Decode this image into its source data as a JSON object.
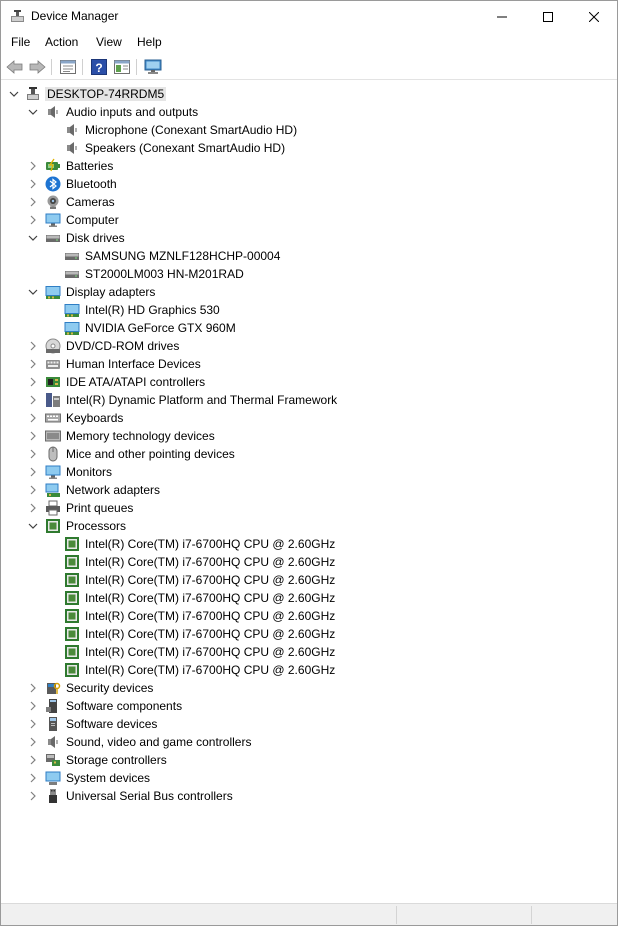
{
  "window": {
    "title": "Device Manager"
  },
  "menu": [
    "File",
    "Action",
    "View",
    "Help"
  ],
  "tree": {
    "root": "DESKTOP-74RRDM5",
    "categories": [
      {
        "label": "Audio inputs and outputs",
        "icon": "speaker-icon",
        "expanded": true,
        "children": [
          "Microphone (Conexant SmartAudio HD)",
          "Speakers (Conexant SmartAudio HD)"
        ],
        "child_icon": "speaker-icon"
      },
      {
        "label": "Batteries",
        "icon": "battery-icon"
      },
      {
        "label": "Bluetooth",
        "icon": "bluetooth-icon"
      },
      {
        "label": "Cameras",
        "icon": "camera-icon"
      },
      {
        "label": "Computer",
        "icon": "monitor-icon"
      },
      {
        "label": "Disk drives",
        "icon": "disk-icon",
        "expanded": true,
        "children": [
          "SAMSUNG MZNLF128HCHP-00004",
          "ST2000LM003 HN-M201RAD"
        ],
        "child_icon": "disk-icon"
      },
      {
        "label": "Display adapters",
        "icon": "display-adapter-icon",
        "expanded": true,
        "children": [
          "Intel(R) HD Graphics 530",
          "NVIDIA GeForce GTX 960M"
        ],
        "child_icon": "display-adapter-icon"
      },
      {
        "label": "DVD/CD-ROM drives",
        "icon": "dvd-icon"
      },
      {
        "label": "Human Interface Devices",
        "icon": "hid-icon"
      },
      {
        "label": "IDE ATA/ATAPI controllers",
        "icon": "ide-icon"
      },
      {
        "label": "Intel(R) Dynamic Platform and Thermal Framework",
        "icon": "intel-icon"
      },
      {
        "label": "Keyboards",
        "icon": "keyboard-icon"
      },
      {
        "label": "Memory technology devices",
        "icon": "memory-icon"
      },
      {
        "label": "Mice and other pointing devices",
        "icon": "mouse-icon"
      },
      {
        "label": "Monitors",
        "icon": "monitor-icon"
      },
      {
        "label": "Network adapters",
        "icon": "network-icon"
      },
      {
        "label": "Print queues",
        "icon": "printer-icon"
      },
      {
        "label": "Processors",
        "icon": "processor-icon",
        "expanded": true,
        "children": [
          "Intel(R) Core(TM) i7-6700HQ CPU @ 2.60GHz",
          "Intel(R) Core(TM) i7-6700HQ CPU @ 2.60GHz",
          "Intel(R) Core(TM) i7-6700HQ CPU @ 2.60GHz",
          "Intel(R) Core(TM) i7-6700HQ CPU @ 2.60GHz",
          "Intel(R) Core(TM) i7-6700HQ CPU @ 2.60GHz",
          "Intel(R) Core(TM) i7-6700HQ CPU @ 2.60GHz",
          "Intel(R) Core(TM) i7-6700HQ CPU @ 2.60GHz",
          "Intel(R) Core(TM) i7-6700HQ CPU @ 2.60GHz"
        ],
        "child_icon": "processor-icon"
      },
      {
        "label": "Security devices",
        "icon": "security-icon"
      },
      {
        "label": "Software components",
        "icon": "software-component-icon"
      },
      {
        "label": "Software devices",
        "icon": "software-device-icon"
      },
      {
        "label": "Sound, video and game controllers",
        "icon": "speaker-icon"
      },
      {
        "label": "Storage controllers",
        "icon": "storage-icon"
      },
      {
        "label": "System devices",
        "icon": "system-icon"
      },
      {
        "label": "Universal Serial Bus controllers",
        "icon": "usb-icon"
      }
    ]
  }
}
